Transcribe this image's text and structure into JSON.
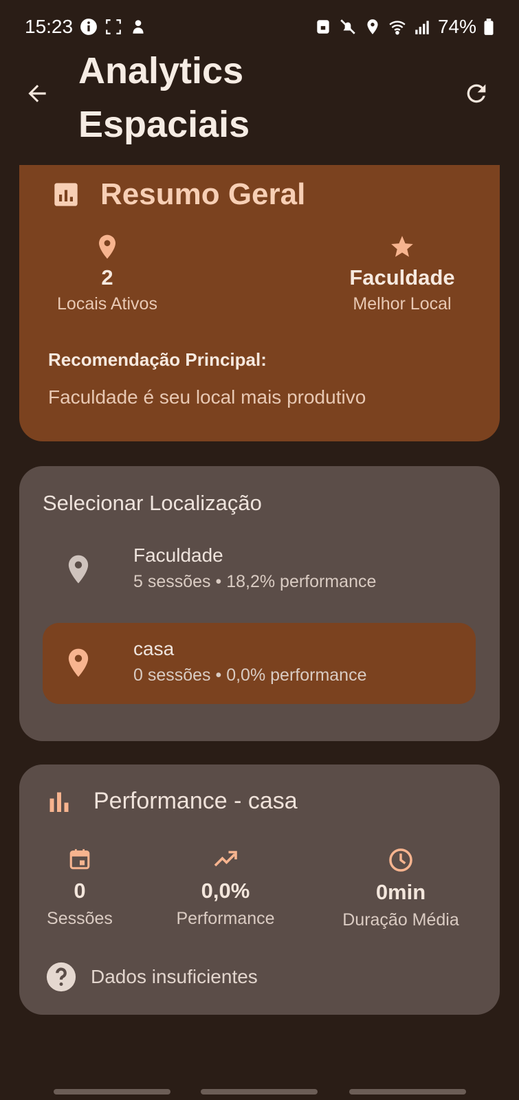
{
  "status_bar": {
    "time": "15:23",
    "battery": "74%",
    "icons_left": [
      "info-icon",
      "screenshot-icon",
      "assistant-icon"
    ],
    "icons_right": [
      "lock-icon",
      "mute-icon",
      "location-icon",
      "wifi-icon",
      "signal-icon",
      "battery-icon"
    ]
  },
  "app_bar": {
    "title_line1": "Analytics",
    "title_line2": "Espaciais",
    "back_icon": "arrow-left-icon",
    "refresh_icon": "refresh-icon"
  },
  "summary": {
    "title": "Resumo Geral",
    "active_locations_value": "2",
    "active_locations_label": "Locais Ativos",
    "best_location_value": "Faculdade",
    "best_location_label": "Melhor Local",
    "recommendation_title": "Recomendação Principal:",
    "recommendation_text": "Faculdade é seu local mais produtivo"
  },
  "select_location": {
    "title": "Selecionar Localização",
    "items": [
      {
        "name": "Faculdade",
        "details": "5 sessões • 18,2% performance",
        "selected": false
      },
      {
        "name": "casa",
        "details": "0 sessões • 0,0% performance",
        "selected": true
      }
    ]
  },
  "performance": {
    "title": "Performance - casa",
    "stats": [
      {
        "icon": "calendar-icon",
        "value": "0",
        "label": "Sessões"
      },
      {
        "icon": "trending-up-icon",
        "value": "0,0%",
        "label": "Performance"
      },
      {
        "icon": "clock-icon",
        "value": "0min",
        "label": "Duração Média"
      }
    ],
    "info_text": "Dados insuficientes"
  },
  "colors": {
    "background": "#2a1d16",
    "summary_card": "#7b421f",
    "neutral_card": "#5b4d48",
    "accent": "#f7b48f"
  }
}
